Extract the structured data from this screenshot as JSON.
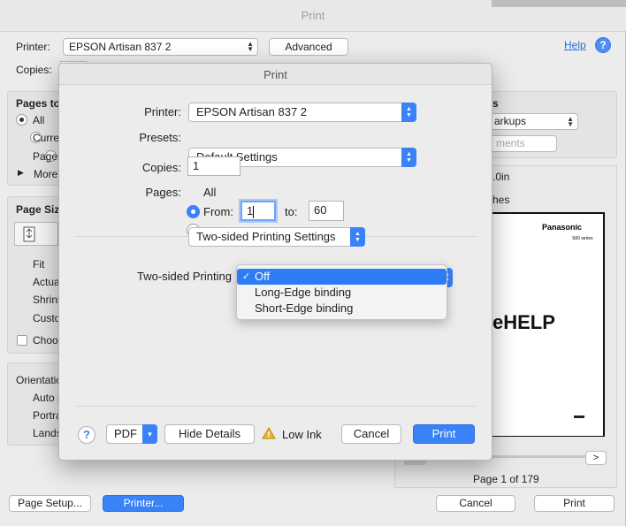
{
  "outer": {
    "title": "Print",
    "printer_label": "Printer:",
    "printer_value": "EPSON Artisan 837 2",
    "advanced_label": "Advanced",
    "help_link": "Help",
    "copies_label": "Copies:",
    "pages_to_print_label": "Pages to",
    "pages_radio_all": "All",
    "pages_radio_current": "Curre",
    "pages_radio_pages": "Pages",
    "more_options": "More",
    "page_sizing_label": "Page Siz",
    "sizing_fit": "Fit",
    "sizing_actual": "Actua",
    "sizing_shrink": "Shrink",
    "sizing_custom": "Custo",
    "choose_paper": "Choos",
    "orientation_label": "Orientatio",
    "orient_auto": "Auto p",
    "orient_portrait": "Portra",
    "orient_landscape": "Lands",
    "comments_header": "s",
    "comments_value": "arkups",
    "summarize_button": "ments",
    "paper_dim": ".0in",
    "inches": "hes",
    "preview_brand": "Panasonic",
    "preview_series": "S60 series",
    "preview_headline": "eHELP",
    "page_indicator": "Page 1 of 179",
    "next_page": ">",
    "page_setup_button": "Page Setup...",
    "printer_button": "Printer...",
    "cancel_button": "Cancel",
    "print_button": "Print"
  },
  "sheet": {
    "title": "Print",
    "printer_label": "Printer:",
    "printer_value": "EPSON Artisan 837 2",
    "presets_label": "Presets:",
    "presets_value": "Default Settings",
    "copies_label": "Copies:",
    "copies_value": "1",
    "pages_label": "Pages:",
    "all_label": "All",
    "from_label": "From:",
    "from_value": "1",
    "to_label": "to:",
    "to_value": "60",
    "panel_select": "Two-sided Printing Settings",
    "two_sided_label": "Two-sided Printing",
    "menu_options": [
      "Off",
      "Long-Edge binding",
      "Short-Edge binding"
    ],
    "menu_selected": "Off",
    "help_symbol": "?",
    "pdf_label": "PDF",
    "hide_details": "Hide Details",
    "low_ink": "Low Ink",
    "cancel": "Cancel",
    "print": "Print"
  },
  "colors": {
    "accent": "#3a82f7",
    "menu_highlight": "#2d7cf6",
    "warning": "#e9b62d"
  }
}
